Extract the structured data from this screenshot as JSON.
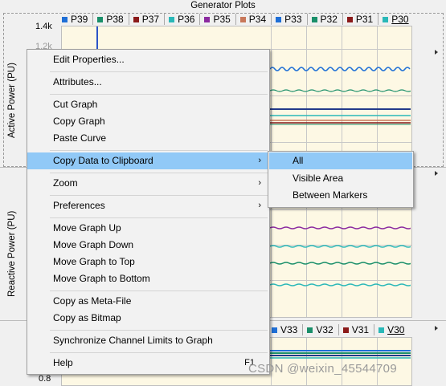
{
  "window": {
    "title": "Generator Plots"
  },
  "top_plot": {
    "legend": [
      {
        "label": "P39",
        "color": "#1f6fd6"
      },
      {
        "label": "P38",
        "color": "#1a8f6a"
      },
      {
        "label": "P37",
        "color": "#8b1a1a"
      },
      {
        "label": "P36",
        "color": "#2ab8b8"
      },
      {
        "label": "P35",
        "color": "#8b2aa0"
      },
      {
        "label": "P34",
        "color": "#c8785a"
      },
      {
        "label": "P33",
        "color": "#1f6fd6"
      },
      {
        "label": "P32",
        "color": "#1a8f6a"
      },
      {
        "label": "P31",
        "color": "#8b1a1a"
      },
      {
        "label": "P30",
        "color": "#2ab8b8"
      }
    ],
    "y_tick": "1.4k",
    "y_tick2": "1.2k",
    "ylabel": "Active Power (PU)"
  },
  "middle_plot": {
    "ylabel": "Reactive Power (PU)"
  },
  "bottom_plot": {
    "legend": [
      {
        "label": "V33",
        "color": "#1f6fd6"
      },
      {
        "label": "V32",
        "color": "#1a8f6a"
      },
      {
        "label": "V31",
        "color": "#8b1a1a"
      },
      {
        "label": "V30",
        "color": "#2ab8b8"
      }
    ],
    "y_tick": "0.8"
  },
  "context_menu": {
    "items": [
      {
        "label": "Edit Properties..."
      },
      {
        "label": "Attributes..."
      },
      {
        "label": "Cut Graph"
      },
      {
        "label": "Copy Graph"
      },
      {
        "label": "Paste Curve"
      },
      {
        "label": "Copy Data to Clipboard",
        "submenu": "›"
      },
      {
        "label": "Zoom",
        "submenu": "›"
      },
      {
        "label": "Preferences",
        "submenu": "›"
      },
      {
        "label": "Move Graph Up"
      },
      {
        "label": "Move Graph Down"
      },
      {
        "label": "Move Graph to Top"
      },
      {
        "label": "Move Graph to Bottom"
      },
      {
        "label": "Copy as Meta-File"
      },
      {
        "label": "Copy as Bitmap"
      },
      {
        "label": "Synchronize Channel Limits to Graph"
      },
      {
        "label": "Help",
        "shortcut": "F1"
      }
    ]
  },
  "submenu": {
    "items": [
      {
        "label": "All"
      },
      {
        "label": "Visible Area"
      },
      {
        "label": "Between Markers"
      }
    ]
  },
  "watermark": "CSDN @weixin_45544709"
}
